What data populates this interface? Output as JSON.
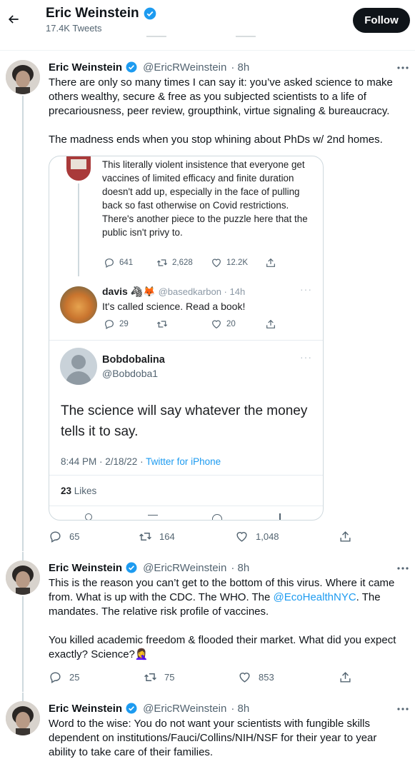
{
  "header": {
    "name": "Eric Weinstein",
    "tweet_count": "17.4K Tweets",
    "follow_label": "Follow",
    "back_icon": "arrow-left-icon",
    "verified_icon": "verified-badge-icon"
  },
  "colors": {
    "accent": "#1d9bf0",
    "text": "#0f1419",
    "muted": "#536471",
    "border": "#eff3f4"
  },
  "tweets": [
    {
      "name": "Eric Weinstein",
      "handle": "@EricRWeinstein",
      "time": "· 8h",
      "para1": "There are only so many times I can say it: you’ve asked science to make others wealthy, secure & free as you subjected scientists to a life of precariousness, peer review, groupthink, virtue signaling & bureaucracy.",
      "para2": "The madness ends when you stop whining about PhDs w/ 2nd homes.",
      "replies": "65",
      "retweets": "164",
      "likes": "1,048"
    },
    {
      "name": "Eric Weinstein",
      "handle": "@EricRWeinstein",
      "time": "· 8h",
      "para1_a": "This is the reason you can’t get to the bottom of this virus. Where it came from. What is up with the CDC. The WHO. The ",
      "para1_link": "@EcoHealthNYC",
      "para1_b": ". The mandates. The relative risk profile of vaccines.",
      "para2": "You killed academic freedom & flooded their market. What did you expect exactly? Science?🤦‍♀️",
      "replies": "25",
      "retweets": "75",
      "likes": "853"
    },
    {
      "name": "Eric Weinstein",
      "handle": "@EricRWeinstein",
      "time": "· 8h",
      "para1": "Word to the wise: You do not want your scientists with fungible skills dependent on institutions/Fauci/Collins/NIH/NSF for their year to year ability to take care of their families."
    }
  ],
  "card": {
    "top_text": "This literally violent insistence that everyone get vaccines of limited efficacy and finite duration doesn't add up, especially in the face of pulling back so fast otherwise on Covid restrictions.",
    "top_text_2": "There's another piece to the puzzle here that the public isn't privy to.",
    "top_replies": "641",
    "top_retweets": "2,628",
    "top_likes": "12.2K",
    "reply1_name": "davis 🦓🦊",
    "reply1_handle": "@basedkarbon · 14h",
    "reply1_text": "It's called science. Read a book!",
    "reply1_replies": "29",
    "reply1_likes": "20",
    "reply2_name": "Bobdobalina",
    "reply2_handle": "@Bobdoba1",
    "reply2_text": "The science will say whatever the money tells it to say.",
    "reply2_time": "8:44 PM · 2/18/22 · ",
    "reply2_source": "Twitter for iPhone",
    "reply2_likes_count": "23",
    "reply2_likes_label": "Likes"
  }
}
